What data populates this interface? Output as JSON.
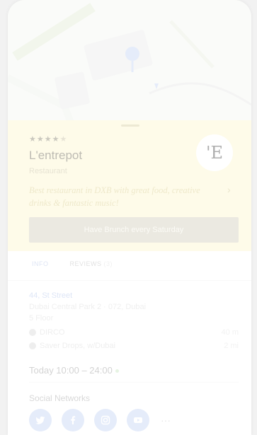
{
  "place": {
    "rating_stars": "★★★★",
    "rating_empty": "★",
    "name": "L'entrepot",
    "category": "Restaurant",
    "logo_letter": "'E",
    "tagline": "Best restaurant in DXB with great food, creative drinks & fantastic music!",
    "promo_button": "Have Brunch every Saturday"
  },
  "tabs": {
    "info": "INFO",
    "reviews": "REVIEWS",
    "reviews_count": "(3)"
  },
  "address": {
    "street": "44, St Street",
    "line": "Dubai Central Park 2 · 072, Dubai",
    "floor": "5 Floor"
  },
  "nearby": [
    {
      "name": "DIRCO",
      "distance": "40 m"
    },
    {
      "name": "Saver Drops, w/Dubai",
      "distance": "2 mi"
    }
  ],
  "hours": "Today 10:00 – 24:00",
  "social": {
    "title": "Social Networks",
    "icons": [
      "twitter-icon",
      "facebook-icon",
      "instagram-icon",
      "youtube-icon"
    ],
    "more": "···"
  },
  "colors": {
    "sheet_bg": "#fdf6cf",
    "accent_blue": "#c6d5f3",
    "promo_bg": "#d3cfbd"
  }
}
